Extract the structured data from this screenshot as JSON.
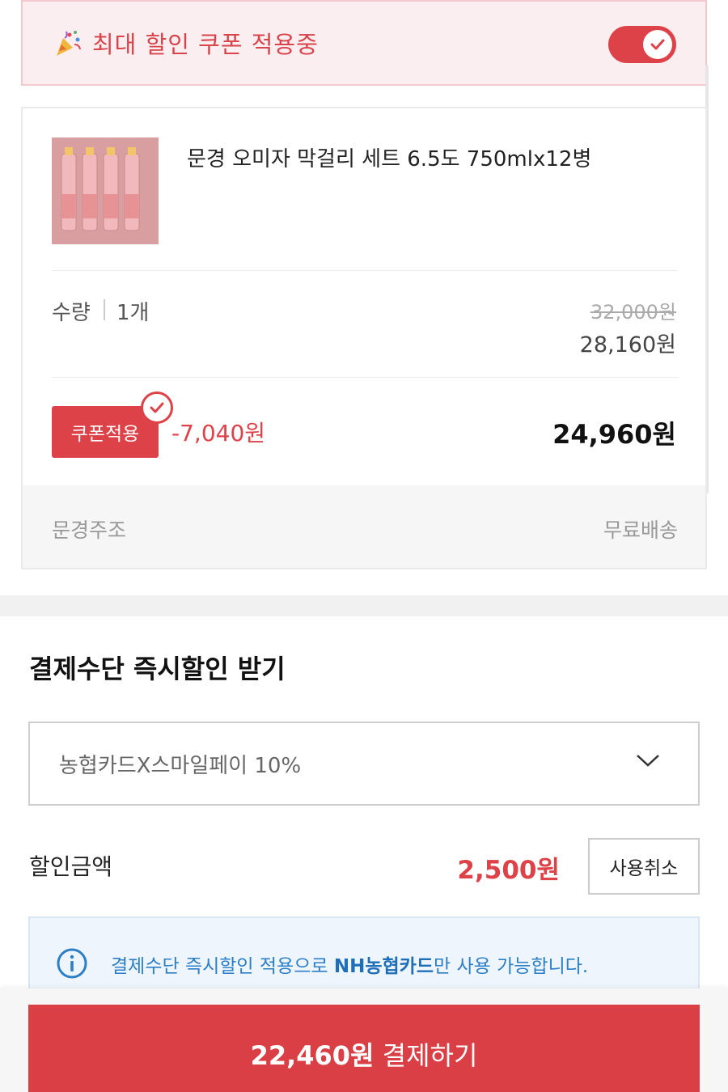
{
  "banner": {
    "text": "최대 할인 쿠폰 적용중",
    "toggle_on": true
  },
  "product": {
    "name": "문경 오미자 막걸리 세트 6.5도 750mlx12병",
    "quantity_label": "수량",
    "quantity_value": "1개",
    "original_price": "32,000원",
    "sale_price": "28,160원",
    "coupon_button": "쿠폰적용",
    "coupon_discount": "-7,040원",
    "final_price": "24,960원",
    "seller": "문경주조",
    "shipping": "무료배송"
  },
  "payment": {
    "section_title": "결제수단 즉시할인 받기",
    "selected_option": "농협카드X스마일페이 10%",
    "discount_label": "할인금액",
    "discount_amount": "2,500원",
    "cancel_button": "사용취소",
    "info_prefix": "결제수단 즉시할인 적용으로 ",
    "info_bold": "NH농협카드",
    "info_suffix": "만 사용 가능합니다."
  },
  "checkout": {
    "amount": "22,460원",
    "label": " 결제하기"
  },
  "colors": {
    "accent": "#de4249",
    "info_blue": "#2c7fc6",
    "banner_bg": "#fbeef0"
  }
}
